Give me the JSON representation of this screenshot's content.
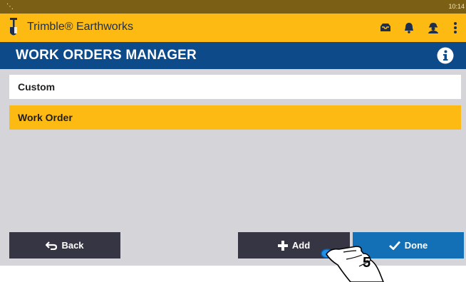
{
  "status_bar": {
    "time": "10:14",
    "notification_icon": "shovel-icon"
  },
  "app_bar": {
    "title": "Trimble® Earthworks",
    "logo_icon": "shovel-logo-icon",
    "icons": [
      "messages-icon",
      "bell-icon",
      "operator-icon",
      "more-vert-icon"
    ]
  },
  "header": {
    "title": "WORK ORDERS MANAGER",
    "info_icon": "info-icon",
    "color": "#0d4a8a"
  },
  "list": {
    "items": [
      {
        "label": "Custom",
        "selected": false
      },
      {
        "label": "Work Order",
        "selected": true
      }
    ]
  },
  "buttons": {
    "back": "Back",
    "add": "Add",
    "done": "Done"
  },
  "annotation": {
    "step": "5",
    "icon": "pointing-hand-icon"
  },
  "colors": {
    "accent_yellow": "#fdba12",
    "done_blue": "#1370b6",
    "dark_button": "#363544"
  }
}
